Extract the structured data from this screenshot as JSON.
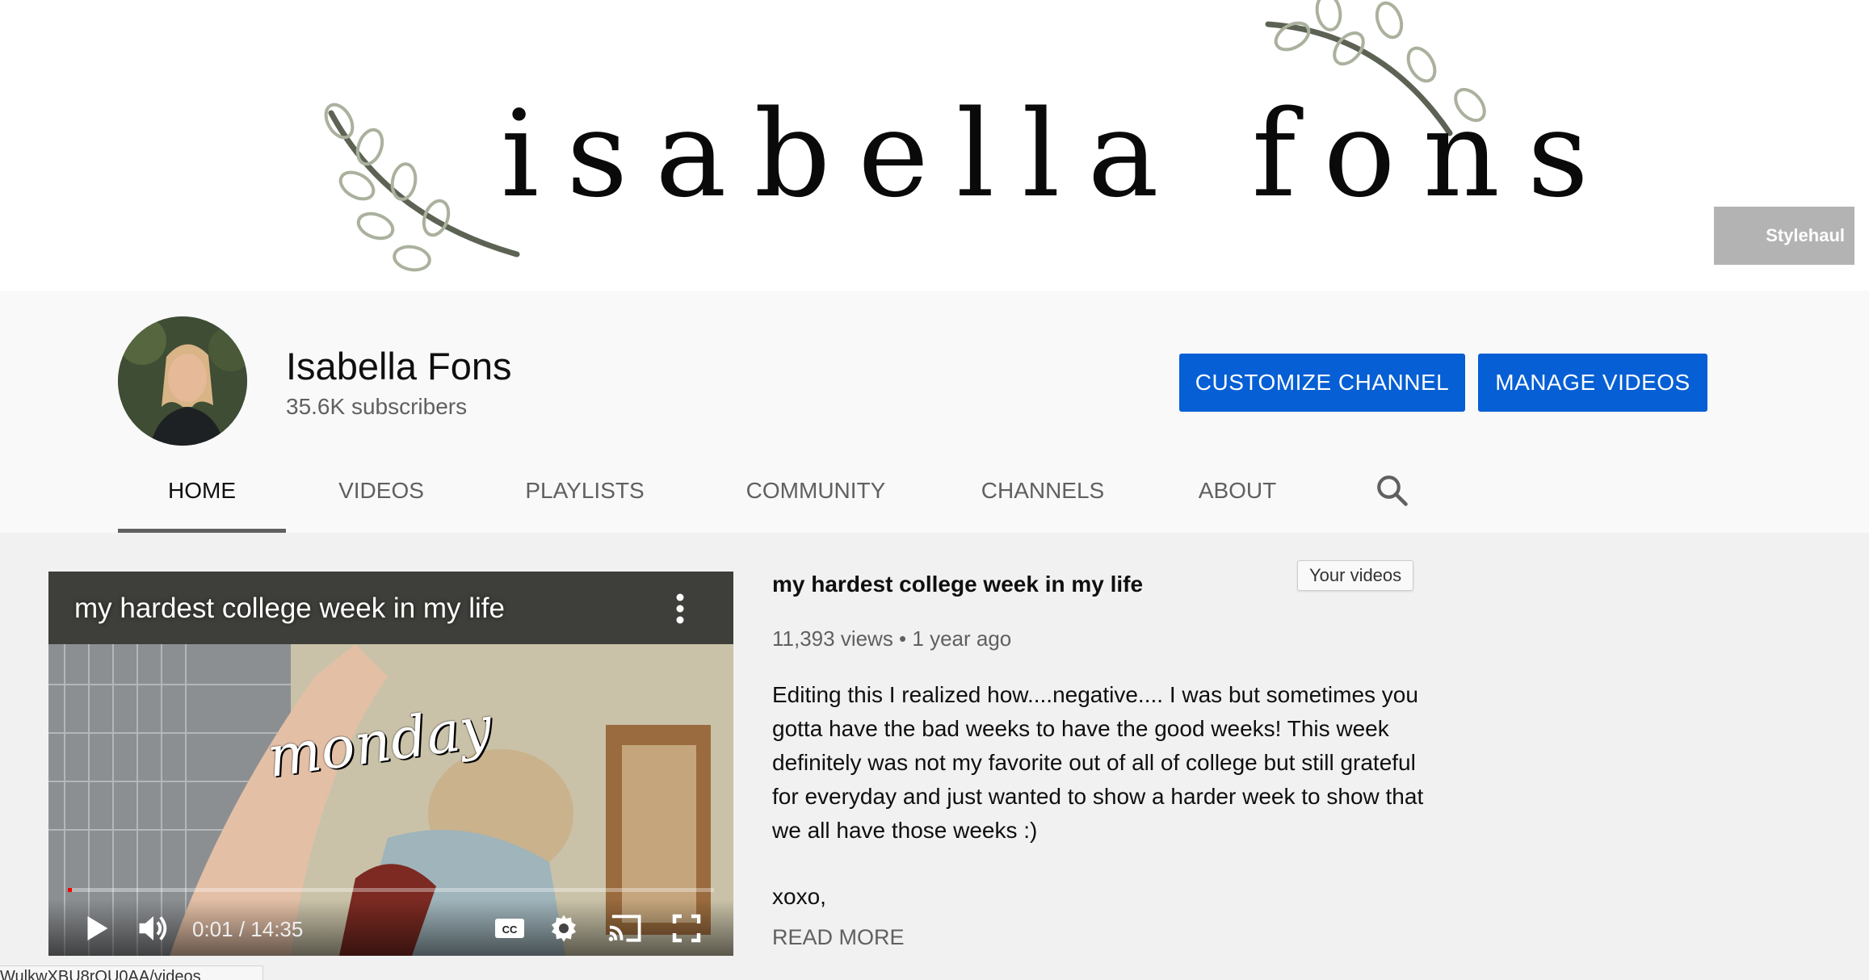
{
  "banner": {
    "title": "isabella fons",
    "watermark_label": "Stylehaul"
  },
  "channel": {
    "name": "Isabella Fons",
    "subscribers": "35.6K subscribers",
    "customize_label": "CUSTOMIZE CHANNEL",
    "manage_label": "MANAGE VIDEOS",
    "accent_color": "#065fd4"
  },
  "tabs": [
    {
      "label": "HOME",
      "active": true
    },
    {
      "label": "VIDEOS",
      "active": false
    },
    {
      "label": "PLAYLISTS",
      "active": false
    },
    {
      "label": "COMMUNITY",
      "active": false
    },
    {
      "label": "CHANNELS",
      "active": false
    },
    {
      "label": "ABOUT",
      "active": false
    }
  ],
  "search_icon": "search-icon",
  "featured": {
    "player_title": "my hardest college week in my life",
    "overlay_text": "monday",
    "time": "0:01 / 14:35",
    "progress_fraction": 0.001,
    "title": "my hardest college week in my life",
    "your_videos_label": "Your videos",
    "meta": "11,393 views • 1 year ago",
    "description": "Editing this I realized how....negative.... I was but sometimes you gotta have the bad weeks to have the good weeks! This week definitely was not my favorite out of all of college but still grateful for everyday and just wanted to show a harder week to show that we all have those weeks :)",
    "signoff": "xoxo,",
    "read_more": "READ MORE"
  },
  "status_bar": {
    "url": "WulkwXBU8rOU0AA/videos"
  }
}
